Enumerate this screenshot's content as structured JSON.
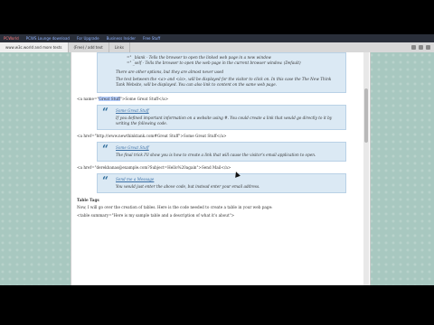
{
  "bookmarks": [
    {
      "label": "PCWorld"
    },
    {
      "label": "PCWS Lounge download"
    },
    {
      "label": "For Upgrade"
    },
    {
      "label": "Business Insider"
    },
    {
      "label": "Free Stuff"
    }
  ],
  "tabs": [
    {
      "label": "www.w3c.world and more tests"
    },
    {
      "label": "(Free) / add text"
    },
    {
      "label": "Links"
    }
  ],
  "page": {
    "target_options": {
      "blank": "=\" _blank - Tells the browser to open the linked web page in a new window",
      "self": "=\" _self - Tells the browser to open the web page in the current browser window. (Default)"
    },
    "other_options": "There are other options, but they are almost never used",
    "text_between": "The text between the <a> and </a>, will be displayed for the visitor to click on. In this case the The New Think Tank Website, will be displayed. You can also link to content on the same web page.",
    "anchor_code_prefix": "<a name=\"",
    "anchor_code_hl": "Great Stuff",
    "anchor_code_suffix": "\">Some Great Stuff</a>",
    "box1_link": "Some Great Stuff",
    "box1_text": "If you defined important information on a website using #. You could create a link that would go directly to it by writing the following code.",
    "href_code": "<a href=\"http://www.newthinktank.com#Great Stuff\">Some Great Stuff</a>",
    "box2_link": "Some Great Stuff",
    "box2_text": "The final trick I'll show you is how to create a link that will cause the visitor's email application to open.",
    "mail_code": "<a href=\"derekbanas@example.com?Subject=Hello%20again\">Send Mail</a>",
    "box3_link": "Send me a Message",
    "box3_text": "You would just enter the above code, but instead enter your email address.",
    "table_heading": "Table Tags",
    "table_intro": "Now, I will go over the creation of tables. Here is the code needed to create a table in your web page:",
    "table_code": "<table summary=\"Here is my sample table and a description of what it's about\">"
  }
}
